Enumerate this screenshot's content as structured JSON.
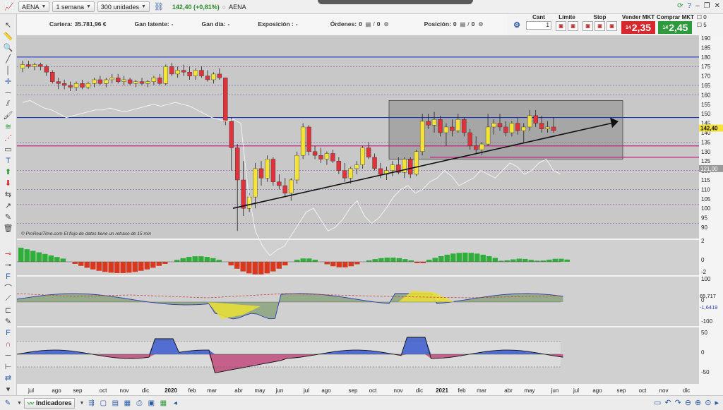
{
  "toolbar": {
    "ticker": "AENA",
    "timeframe": "1 semana",
    "units": "300 unidades",
    "price_change": "142,40 (+0,81%)",
    "instrument_name": "AENA"
  },
  "info": {
    "cartera_label": "Cartera:",
    "cartera_value": "35.781,96 €",
    "gan_latente_label": "Gan latente:",
    "gan_latente_value": "-",
    "gan_dia_label": "Gan día:",
    "gan_dia_value": "-",
    "exposicion_label": "Exposición :",
    "exposicion_value": "-",
    "ordenes_label": "Órdenes:",
    "ordenes_value": "0",
    "ordenes_value2": "0",
    "posicion_label": "Posición:",
    "posicion_value": "0",
    "posicion_value2": "0"
  },
  "ticket": {
    "cant_label": "Cant",
    "cant_value": "1",
    "limite_label": "Límite",
    "stop_label": "Stop",
    "sell_label": "Vender MKT",
    "sell_prefix": "14",
    "sell_price": "2,35",
    "buy_label": "Comprar MKT",
    "buy_prefix": "14",
    "buy_price": "2,45",
    "opt1": "0",
    "opt2": "5"
  },
  "chart_note": "© ProRealTime.com  El flujo de datos tiene un retraso de 15 min",
  "price_axis": {
    "ticks": [
      190,
      185,
      180,
      175,
      170,
      165,
      160,
      155,
      150,
      145,
      140,
      135,
      130,
      125,
      120,
      115,
      110,
      105,
      100,
      95,
      90
    ],
    "last_price": "142,40",
    "marker_price": "121,00"
  },
  "osc1_axis": {
    "ticks": [
      "2",
      "0",
      "-2"
    ]
  },
  "osc2_axis": {
    "ticks": [
      "100",
      "0",
      "-100"
    ],
    "value_a": "65,717",
    "value_b": "-1,6419"
  },
  "osc3_axis": {
    "ticks": [
      "50",
      "0",
      "-50"
    ]
  },
  "x_axis": {
    "labels": [
      "jul",
      "ago",
      "sep",
      "oct",
      "nov",
      "dic",
      "2020",
      "feb",
      "mar",
      "abr",
      "may",
      "jun",
      "jul",
      "ago",
      "sep",
      "oct",
      "nov",
      "dic",
      "2021",
      "feb",
      "mar",
      "abr",
      "may",
      "jun",
      "jul",
      "ago",
      "sep",
      "oct",
      "nov",
      "dic"
    ]
  },
  "bottom": {
    "indicators_label": "Indicadores"
  },
  "colors": {
    "bull": "#f5e33a",
    "bear": "#e0323b",
    "blue_line": "#1d35c4",
    "magenta_line": "#c1257f",
    "hist_up": "#2fae3a",
    "hist_down": "#d9381f"
  }
}
